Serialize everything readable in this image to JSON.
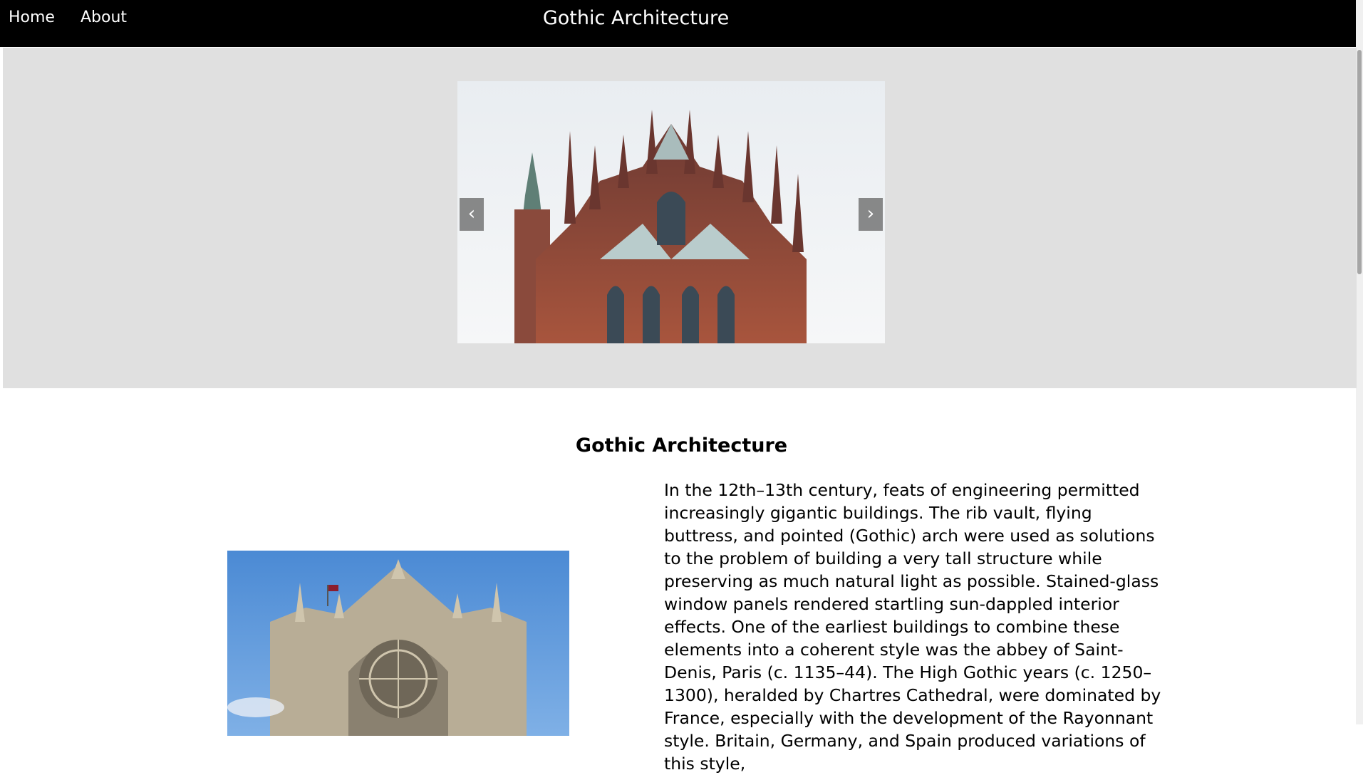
{
  "nav": {
    "links": [
      {
        "label": "Home"
      },
      {
        "label": "About"
      }
    ],
    "title": "Gothic Architecture"
  },
  "carousel": {
    "prev_label": "‹",
    "next_label": "›",
    "image_subject": "red-stone gothic cathedral with spires and flying buttresses"
  },
  "article": {
    "heading": "Gothic Architecture",
    "image_subject": "gothic cathedral west front against blue sky",
    "body": "In the 12th–13th century, feats of engineering permitted increasingly gigantic buildings. The rib vault, flying buttress, and pointed (Gothic) arch were used as solutions to the problem of building a very tall structure while preserving as much natural light as possible. Stained-glass window panels rendered startling sun-dappled interior effects. One of the earliest buildings to combine these elements into a coherent style was the abbey of Saint-Denis, Paris (c. 1135–44). The High Gothic years (c. 1250–1300), heralded by Chartres Cathedral, were dominated by France, especially with the development of the Rayonnant style. Britain, Germany, and Spain produced variations of this style,"
  },
  "colors": {
    "navbar": "#000000",
    "hero_background": "#e0e0e0",
    "page_background": "#ffffff"
  }
}
